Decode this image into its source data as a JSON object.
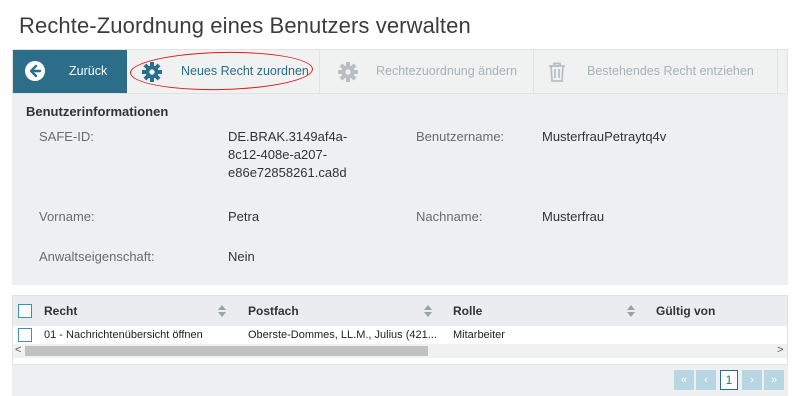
{
  "page": {
    "title": "Rechte-Zuordnung eines Benutzers verwalten"
  },
  "toolbar": {
    "back_label": "Zurück",
    "new_label": "Neues Recht zuordnen",
    "change_label": "Rechtezuordnung ändern",
    "revoke_label": "Bestehendes Recht entziehen",
    "accent_color": "#2c6e8a",
    "disabled_color": "#a9b2b5",
    "annotation_color": "#e01b1b"
  },
  "info": {
    "title": "Benutzerinformationen",
    "safe_id_label": "SAFE-ID:",
    "safe_id_value_line1": "DE.BRAK.3149af4a-",
    "safe_id_value_line2": "8c12-408e-a207-",
    "safe_id_value_line3": "e86e72858261.ca8d",
    "username_label": "Benutzername:",
    "username_value": "MusterfrauPetraytq4v",
    "firstname_label": "Vorname:",
    "firstname_value": "Petra",
    "lastname_label": "Nachname:",
    "lastname_value": "Musterfrau",
    "lawyer_label": "Anwaltseigenschaft:",
    "lawyer_value": "Nein"
  },
  "grid": {
    "columns": [
      "Recht",
      "Postfach",
      "Rolle",
      "Gültig von"
    ],
    "rows": [
      {
        "recht": "01 - Nachrichtenübersicht öffnen",
        "postfach": "Oberste-Dommes, LL.M., Julius (421...",
        "rolle": "Mitarbeiter",
        "gueltig_von": ""
      }
    ]
  },
  "pager": {
    "first": "«",
    "prev": "‹",
    "current_page": "1",
    "next": "›",
    "last": "»"
  }
}
